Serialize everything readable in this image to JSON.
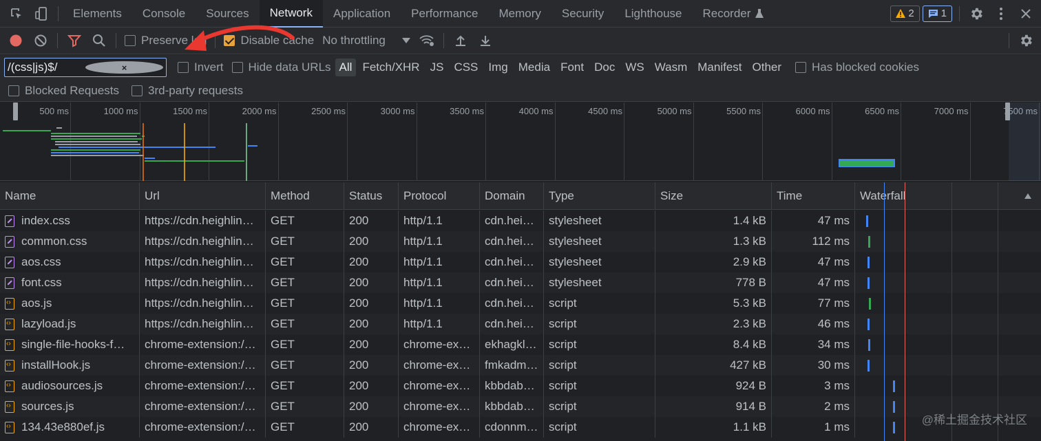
{
  "tabs": {
    "items": [
      {
        "label": "Elements"
      },
      {
        "label": "Console"
      },
      {
        "label": "Sources"
      },
      {
        "label": "Network"
      },
      {
        "label": "Application"
      },
      {
        "label": "Performance"
      },
      {
        "label": "Memory"
      },
      {
        "label": "Security"
      },
      {
        "label": "Lighthouse"
      },
      {
        "label": "Recorder"
      }
    ],
    "active": "Network",
    "warnings_count": "2",
    "messages_count": "1"
  },
  "toolbar": {
    "preserve_log_label": "Preserve log",
    "disable_cache_label": "Disable cache",
    "throttling_value": "No throttling"
  },
  "filter": {
    "value": "/(css|js)$/",
    "invert_label": "Invert",
    "hide_data_urls_label": "Hide data URLs",
    "types": [
      "All",
      "Fetch/XHR",
      "JS",
      "CSS",
      "Img",
      "Media",
      "Font",
      "Doc",
      "WS",
      "Wasm",
      "Manifest",
      "Other"
    ],
    "active_type": "All",
    "has_blocked_cookies_label": "Has blocked cookies",
    "blocked_requests_label": "Blocked Requests",
    "third_party_label": "3rd-party requests"
  },
  "overview": {
    "ticks": [
      "500 ms",
      "1000 ms",
      "1500 ms",
      "2000 ms",
      "2500 ms",
      "3000 ms",
      "3500 ms",
      "4000 ms",
      "4500 ms",
      "5000 ms",
      "5500 ms",
      "6000 ms",
      "6500 ms",
      "7000 ms",
      "7500 ms"
    ]
  },
  "table": {
    "headers": {
      "name": "Name",
      "url": "Url",
      "method": "Method",
      "status": "Status",
      "protocol": "Protocol",
      "domain": "Domain",
      "type": "Type",
      "size": "Size",
      "time": "Time",
      "waterfall": "Waterfall"
    },
    "rows": [
      {
        "kind": "css",
        "name": "index.css",
        "url": "https://cdn.heighlin…",
        "method": "GET",
        "status": "200",
        "protocol": "http/1.1",
        "domain": "cdn.hei…",
        "type": "stylesheet",
        "size": "1.4 kB",
        "time": "47 ms"
      },
      {
        "kind": "css",
        "name": "common.css",
        "url": "https://cdn.heighlin…",
        "method": "GET",
        "status": "200",
        "protocol": "http/1.1",
        "domain": "cdn.hei…",
        "type": "stylesheet",
        "size": "1.3 kB",
        "time": "112 ms"
      },
      {
        "kind": "css",
        "name": "aos.css",
        "url": "https://cdn.heighlin…",
        "method": "GET",
        "status": "200",
        "protocol": "http/1.1",
        "domain": "cdn.hei…",
        "type": "stylesheet",
        "size": "2.9 kB",
        "time": "47 ms"
      },
      {
        "kind": "css",
        "name": "font.css",
        "url": "https://cdn.heighlin…",
        "method": "GET",
        "status": "200",
        "protocol": "http/1.1",
        "domain": "cdn.hei…",
        "type": "stylesheet",
        "size": "778 B",
        "time": "47 ms"
      },
      {
        "kind": "js",
        "name": "aos.js",
        "url": "https://cdn.heighlin…",
        "method": "GET",
        "status": "200",
        "protocol": "http/1.1",
        "domain": "cdn.hei…",
        "type": "script",
        "size": "5.3 kB",
        "time": "77 ms"
      },
      {
        "kind": "js",
        "name": "lazyload.js",
        "url": "https://cdn.heighlin…",
        "method": "GET",
        "status": "200",
        "protocol": "http/1.1",
        "domain": "cdn.hei…",
        "type": "script",
        "size": "2.3 kB",
        "time": "46 ms"
      },
      {
        "kind": "js",
        "name": "single-file-hooks-f…",
        "url": "chrome-extension:/…",
        "method": "GET",
        "status": "200",
        "protocol": "chrome-ex…",
        "domain": "ekhagkl…",
        "type": "script",
        "size": "8.4 kB",
        "time": "34 ms"
      },
      {
        "kind": "js",
        "name": "installHook.js",
        "url": "chrome-extension:/…",
        "method": "GET",
        "status": "200",
        "protocol": "chrome-ex…",
        "domain": "fmkadm…",
        "type": "script",
        "size": "427 kB",
        "time": "30 ms"
      },
      {
        "kind": "js",
        "name": "audiosources.js",
        "url": "chrome-extension:/…",
        "method": "GET",
        "status": "200",
        "protocol": "chrome-ex…",
        "domain": "kbbdab…",
        "type": "script",
        "size": "924 B",
        "time": "3 ms"
      },
      {
        "kind": "js",
        "name": "sources.js",
        "url": "chrome-extension:/…",
        "method": "GET",
        "status": "200",
        "protocol": "chrome-ex…",
        "domain": "kbbdab…",
        "type": "script",
        "size": "914 B",
        "time": "2 ms"
      },
      {
        "kind": "js",
        "name": "134.43e880ef.js",
        "url": "chrome-extension:/…",
        "method": "GET",
        "status": "200",
        "protocol": "chrome-ex…",
        "domain": "cdonnm…",
        "type": "script",
        "size": "1.1 kB",
        "time": "1 ms"
      }
    ]
  },
  "watermark": "@稀土掘金技术社区",
  "colors": {
    "accent": "#8ab4f8",
    "record": "#e46962",
    "checkbox_checked": "#e8a33d",
    "annotation_arrow": "#e8382f"
  }
}
